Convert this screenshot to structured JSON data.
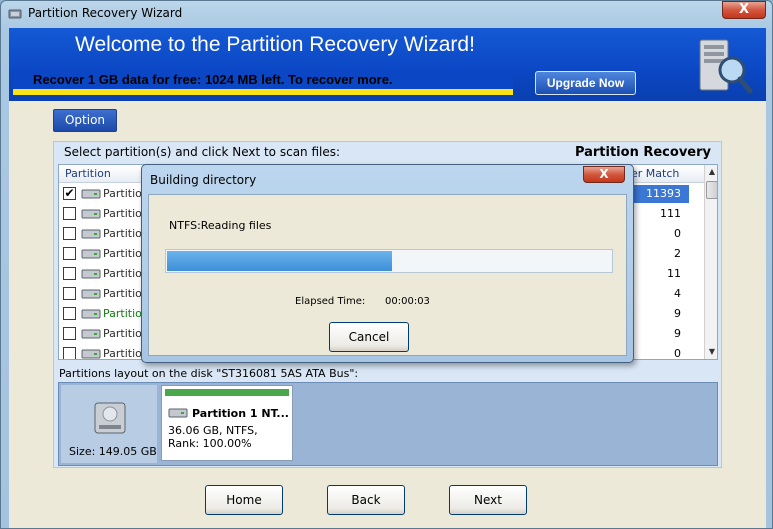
{
  "window": {
    "title": "Partition Recovery Wizard",
    "close_glyph": "X"
  },
  "banner": {
    "title": "Welcome to the Partition Recovery Wizard!",
    "subtitle": "Recover 1 GB data for free: 1024 MB left. To recover more.",
    "upgrade_label": "Upgrade Now",
    "icon": "computer-search-icon"
  },
  "toolbar": {
    "option_label": "Option"
  },
  "panel": {
    "caption": "Select  partition(s) and click Next to scan files:",
    "right_title": "Partition Recovery",
    "columns": {
      "partition": "Partition",
      "match": "der Match"
    },
    "rows": [
      {
        "label": "Partition",
        "count": "11393",
        "checked": true,
        "selected": true,
        "green": false
      },
      {
        "label": "Partition",
        "count": "111",
        "checked": false,
        "selected": false,
        "green": false
      },
      {
        "label": "Partition",
        "count": "0",
        "checked": false,
        "selected": false,
        "green": false
      },
      {
        "label": "Partition",
        "count": "2",
        "checked": false,
        "selected": false,
        "green": false
      },
      {
        "label": "Partition",
        "count": "11",
        "checked": false,
        "selected": false,
        "green": false
      },
      {
        "label": "Partition",
        "count": "4",
        "checked": false,
        "selected": false,
        "green": false
      },
      {
        "label": "Partition",
        "count": "9",
        "checked": false,
        "selected": false,
        "green": true
      },
      {
        "label": "Partition",
        "count": "9",
        "checked": false,
        "selected": false,
        "green": false
      },
      {
        "label": "Partition",
        "count": "0",
        "checked": false,
        "selected": false,
        "green": false
      }
    ],
    "check_glyph": "✔"
  },
  "layout": {
    "caption": "Partitions layout on the disk \"ST316081  5AS   ATA Bus\":",
    "disk_size": "Size: 149.05 GB",
    "partition_title": "Partition 1 NT...",
    "partition_info_1": "36.06 GB, NTFS,",
    "partition_info_2": "Rank: 100.00%"
  },
  "nav": {
    "home_label": "Home",
    "back_label": "Back",
    "next_label": "Next"
  },
  "dialog": {
    "title": "Building directory",
    "close_glyph": "X",
    "status": "NTFS:Reading files",
    "progress_fraction": 0.505,
    "elapsed_label": "Elapsed Time:",
    "elapsed_value": "00:00:03",
    "cancel_label": "Cancel"
  },
  "scroll": {
    "up_glyph": "▲",
    "down_glyph": "▼"
  }
}
